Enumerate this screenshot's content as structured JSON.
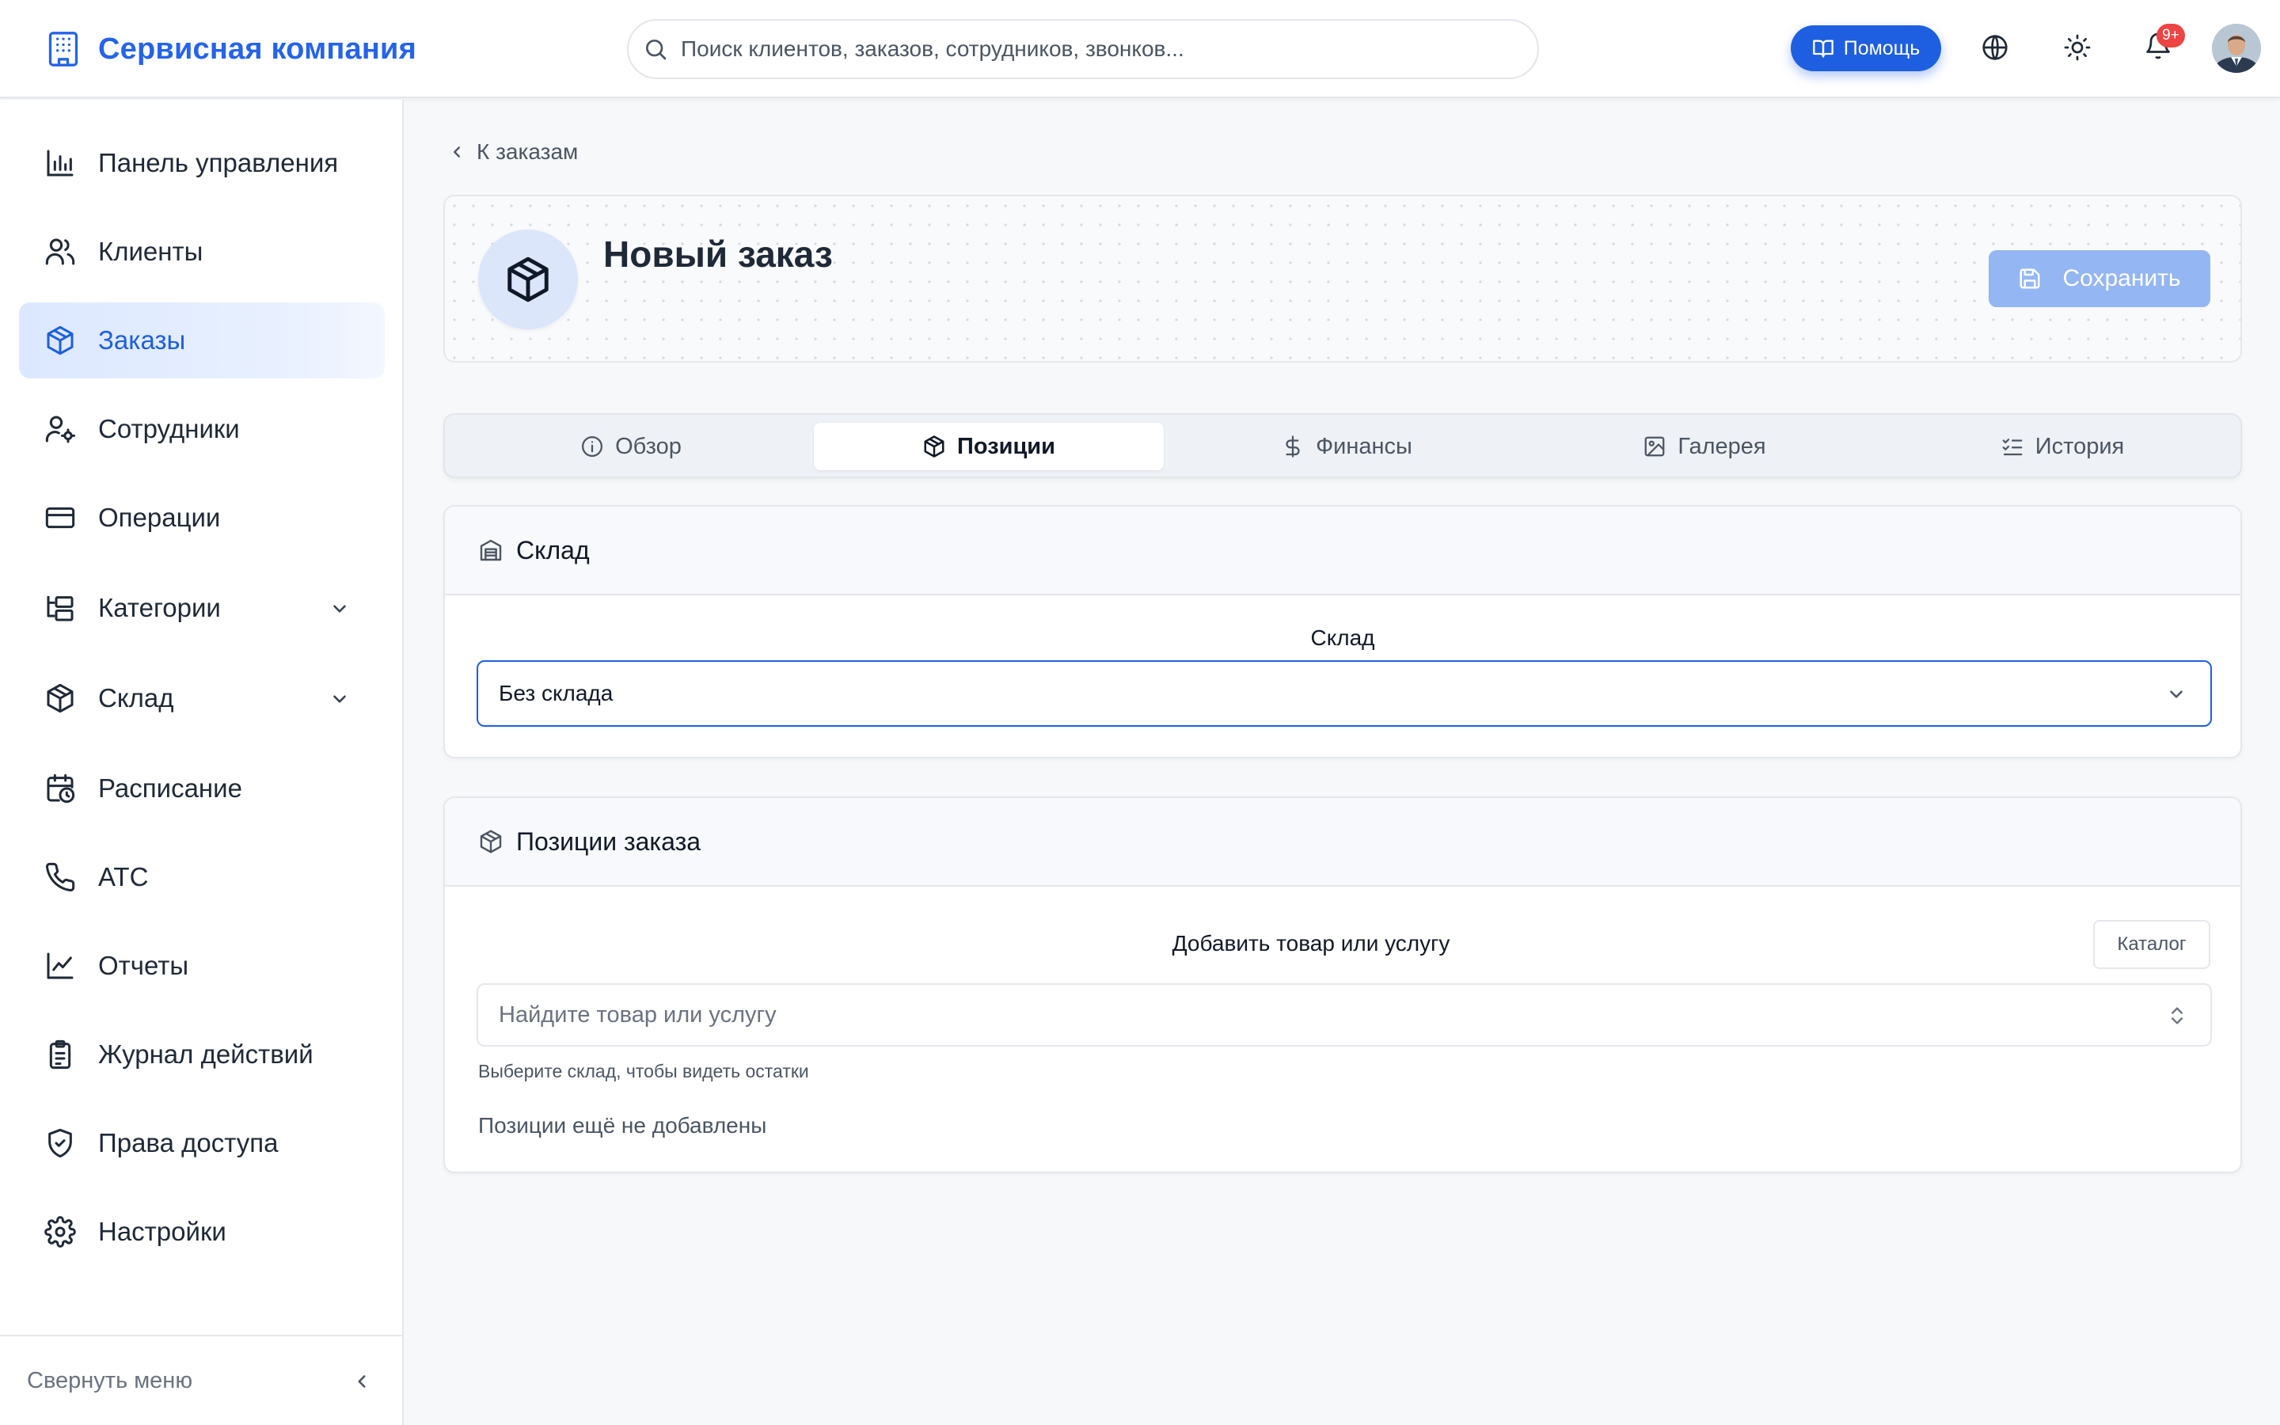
{
  "header": {
    "brand": "Сервисная компания",
    "search_placeholder": "Поиск клиентов, заказов, сотрудников, звонков...",
    "help_label": "Помощь",
    "notifications_badge": "9+"
  },
  "sidebar": {
    "items": [
      {
        "label": "Панель управления",
        "icon": "bar-chart-icon"
      },
      {
        "label": "Клиенты",
        "icon": "users-icon"
      },
      {
        "label": "Заказы",
        "icon": "box-icon",
        "active": true
      },
      {
        "label": "Сотрудники",
        "icon": "user-settings-icon"
      },
      {
        "label": "Операции",
        "icon": "credit-card-icon"
      },
      {
        "label": "Категории",
        "icon": "folder-tree-icon",
        "expandable": true
      },
      {
        "label": "Склад",
        "icon": "box-icon",
        "expandable": true
      },
      {
        "label": "Расписание",
        "icon": "calendar-clock-icon"
      },
      {
        "label": "АТС",
        "icon": "phone-icon"
      },
      {
        "label": "Отчеты",
        "icon": "line-chart-icon"
      },
      {
        "label": "Журнал действий",
        "icon": "clipboard-list-icon"
      },
      {
        "label": "Права доступа",
        "icon": "shield-check-icon"
      },
      {
        "label": "Настройки",
        "icon": "gear-icon"
      }
    ],
    "collapse_label": "Свернуть меню"
  },
  "main": {
    "back_label": "К заказам",
    "title": "Новый заказ",
    "save_label": "Сохранить",
    "tabs": [
      {
        "label": "Обзор",
        "icon": "info-icon"
      },
      {
        "label": "Позиции",
        "icon": "boxes-icon",
        "active": true
      },
      {
        "label": "Финансы",
        "icon": "dollar-icon"
      },
      {
        "label": "Галерея",
        "icon": "image-icon"
      },
      {
        "label": "История",
        "icon": "list-checks-icon"
      }
    ],
    "warehouse": {
      "title": "Склад",
      "field_label": "Склад",
      "selected": "Без склада"
    },
    "positions": {
      "title": "Позиции заказа",
      "add_label": "Добавить товар или услугу",
      "catalog_label": "Каталог",
      "search_placeholder": "Найдите товар или услугу",
      "hint": "Выберите склад, чтобы видеть остатки",
      "empty": "Позиции ещё не добавлены"
    }
  },
  "colors": {
    "accent": "#1d5fe0",
    "brand": "#2563eb",
    "badge": "#ef4444",
    "save_disabled": "#94b6f3"
  }
}
